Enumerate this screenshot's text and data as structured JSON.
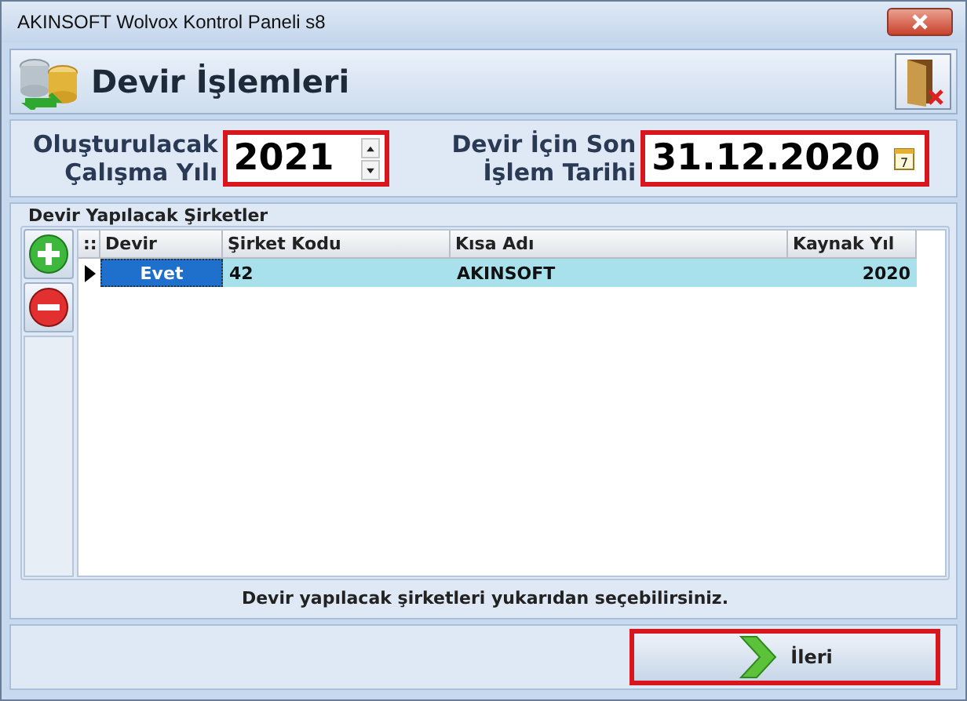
{
  "window": {
    "title": "AKINSOFT Wolvox Kontrol Paneli s8"
  },
  "header": {
    "title": "Devir İşlemleri"
  },
  "fields": [
    {
      "kind": "spin",
      "label_lines": [
        "Oluşturulacak",
        "Çalışma Yılı"
      ],
      "value": "2021"
    },
    {
      "kind": "date",
      "label_lines": [
        "Devir İçin Son",
        "İşlem Tarihi"
      ],
      "value": "31.12.2020",
      "calendar_day": "7"
    }
  ],
  "group": {
    "title": "Devir Yapılacak Şirketler",
    "indicator_header": "::",
    "hint": "Devir yapılacak şirketleri yukarıdan seçebilirsiniz."
  },
  "table": {
    "columns": [
      {
        "label": "Devir"
      },
      {
        "label": "Şirket Kodu"
      },
      {
        "label": "Kısa Adı"
      },
      {
        "label": "Kaynak Yıl"
      }
    ],
    "rows": [
      {
        "selected": true,
        "cells": [
          "Evet",
          "42",
          "AKINSOFT",
          "2020"
        ]
      }
    ]
  },
  "buttons": [
    {
      "label": "İleri"
    }
  ]
}
